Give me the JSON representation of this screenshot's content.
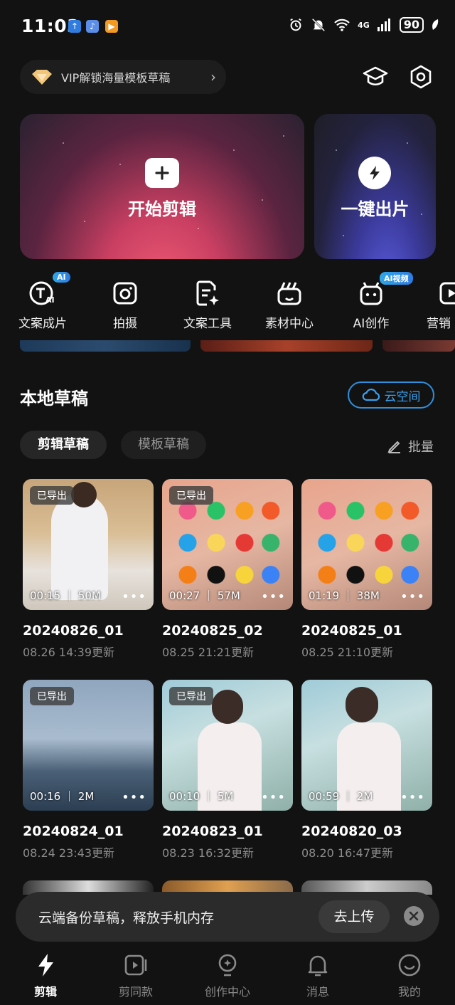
{
  "status_bar": {
    "time": "11:03",
    "network": "4G",
    "battery": "90"
  },
  "vip_banner": {
    "badge": "VIP",
    "text": "VIP解锁海量模板草稿"
  },
  "hero": {
    "start_edit": "开始剪辑",
    "one_click": "一键出片"
  },
  "tools": [
    {
      "label": "文案成片",
      "tag": "AI"
    },
    {
      "label": "拍摄",
      "tag": ""
    },
    {
      "label": "文案工具",
      "tag": ""
    },
    {
      "label": "素材中心",
      "tag": ""
    },
    {
      "label": "AI创作",
      "tag": "AI视频"
    },
    {
      "label": "营销",
      "tag": ""
    }
  ],
  "drafts_section": {
    "title": "本地草稿",
    "cloud_button": "云空间",
    "tabs": [
      "剪辑草稿",
      "模板草稿"
    ],
    "batch": "批量"
  },
  "drafts": [
    {
      "name": "20240826_01",
      "date": "08.26 14:39更新",
      "duration": "00:15",
      "size": "50M",
      "badge": "已导出"
    },
    {
      "name": "20240825_02",
      "date": "08.25 21:21更新",
      "duration": "00:27",
      "size": "57M",
      "badge": "已导出"
    },
    {
      "name": "20240825_01",
      "date": "08.25 21:10更新",
      "duration": "01:19",
      "size": "38M",
      "badge": ""
    },
    {
      "name": "20240824_01",
      "date": "08.24 23:43更新",
      "duration": "00:16",
      "size": "2M",
      "badge": "已导出"
    },
    {
      "name": "20240823_01",
      "date": "08.23 16:32更新",
      "duration": "00:10",
      "size": "5M",
      "badge": "已导出"
    },
    {
      "name": "20240820_03",
      "date": "08.20 16:47更新",
      "duration": "00:59",
      "size": "2M",
      "badge": ""
    }
  ],
  "toast": {
    "text": "云端备份草稿，释放手机内存",
    "button": "去上传"
  },
  "bottom_nav": [
    {
      "label": "剪辑",
      "icon": "scissors-bolt-icon"
    },
    {
      "label": "剪同款",
      "icon": "template-icon"
    },
    {
      "label": "创作中心",
      "icon": "lightbulb-icon"
    },
    {
      "label": "消息",
      "icon": "bell-icon"
    },
    {
      "label": "我的",
      "icon": "smile-icon"
    }
  ],
  "colors": {
    "accent_blue": "#2e8fdc",
    "card_pink": "#f05a73",
    "card_blue": "#5d5fe6",
    "background": "#121212"
  }
}
